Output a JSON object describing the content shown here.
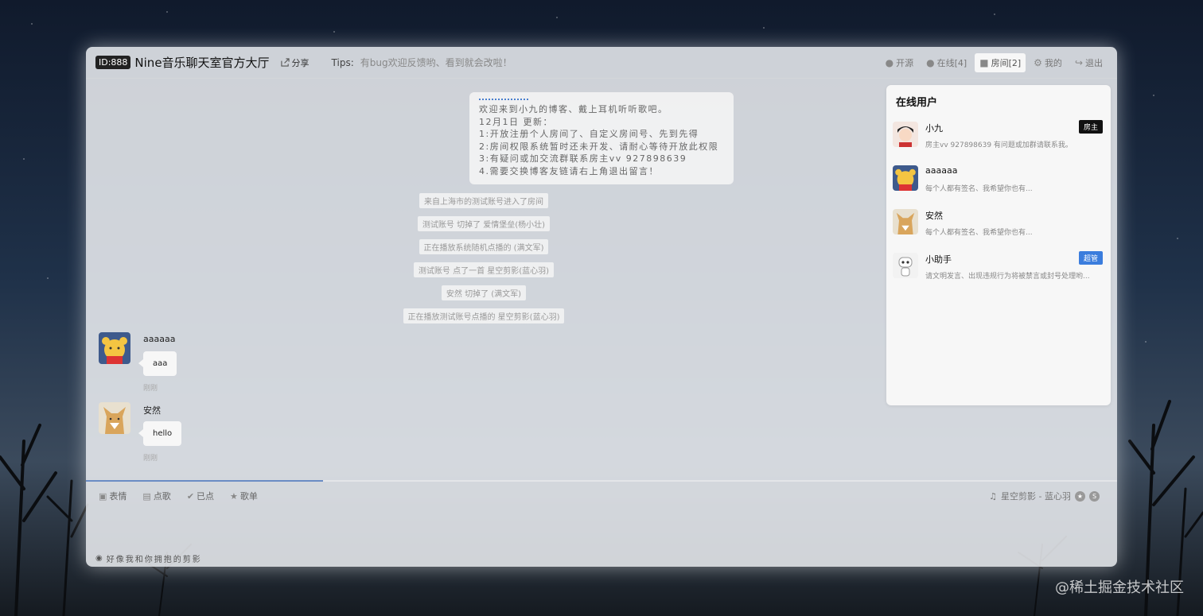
{
  "header": {
    "room_id": "ID:888",
    "room_title": "Nine音乐聊天室官方大厅",
    "share_label": "分享",
    "tips_label": "Tips:",
    "tips_text": "有bug欢迎反馈哟、看到就会改啦！",
    "nav": [
      {
        "label": "开源",
        "icon": "github-icon"
      },
      {
        "label": "在线[4]",
        "icon": "user-icon"
      },
      {
        "label": "房间[2]",
        "icon": "book-icon"
      },
      {
        "label": "我的",
        "icon": "gear-icon"
      },
      {
        "label": "退出",
        "icon": "logout-icon"
      }
    ],
    "active_nav": "房间[2]"
  },
  "notice": {
    "lines": [
      "欢迎来到小九的博客、戴上耳机听听歌吧。",
      "12月1日 更新：",
      "1:开放注册个人房间了、自定义房间号、先到先得",
      "2:房间权限系统暂时还未开发、请耐心等待开放此权限",
      "3:有疑问或加交流群联系房主vv 927898639",
      "4.需要交换博客友链请右上角退出留言！"
    ]
  },
  "system_messages": [
    "来自上海市的测试账号进入了房间",
    "测试账号 切掉了 爱情堡垒(杨小壮)",
    "正在播放系统随机点播的 (满文军)",
    "测试账号 点了一首 星空剪影(蓝心羽)",
    "安然 切掉了 (满文军)",
    "正在播放测试账号点播的 星空剪影(蓝心羽)"
  ],
  "chat": [
    {
      "name": "aaaaaa",
      "text": "aaa",
      "time": "刚刚"
    },
    {
      "name": "安然",
      "text": "hello",
      "time": "刚刚"
    }
  ],
  "online_users": {
    "title": "在线用户",
    "users": [
      {
        "name": "小九",
        "sign": "房主vv 927898639 有问题或加群请联系我。",
        "badge": "房主",
        "badge_color": "#111111"
      },
      {
        "name": "aaaaaa",
        "sign": "每个人都有签名、我希望你也有...",
        "badge": "",
        "badge_color": ""
      },
      {
        "name": "安然",
        "sign": "每个人都有签名、我希望你也有...",
        "badge": "",
        "badge_color": ""
      },
      {
        "name": "小助手",
        "sign": "请文明发言、出现违规行为将被禁言或封号处理哟...",
        "badge": "超管",
        "badge_color": "#3b7ddd"
      }
    ]
  },
  "toolbar": {
    "tools": [
      {
        "label": "表情",
        "icon": "image-icon"
      },
      {
        "label": "点歌",
        "icon": "inbox-icon"
      },
      {
        "label": "已点",
        "icon": "check-circle-icon"
      },
      {
        "label": "歌单",
        "icon": "star-icon"
      }
    ],
    "now_playing": "星空剪影 - 蓝心羽",
    "progress": 0.23
  },
  "lyric": "好像我和你拥抱的剪影",
  "watermark": "@稀土掘金技术社区"
}
